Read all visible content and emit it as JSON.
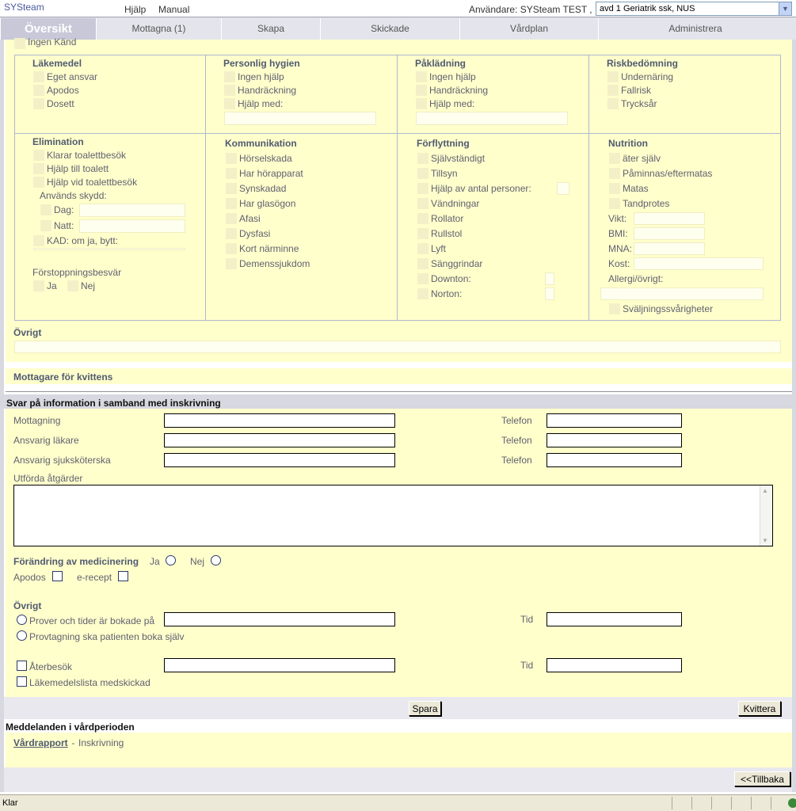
{
  "header": {
    "app_name": "SYSteam",
    "menu_help": "Hjälp",
    "menu_manual": "Manual",
    "user_label": "Användare: SYSteam TEST ,",
    "unit_select": "avd 1 Geriatrik ssk, NUS"
  },
  "tabs": [
    {
      "label": "Översikt"
    },
    {
      "label": "Mottagna (1)"
    },
    {
      "label": "Skapa"
    },
    {
      "label": "Skickade"
    },
    {
      "label": "Vårdplan"
    },
    {
      "label": "Administrera"
    }
  ],
  "top_cut_label": "Ingen Känd",
  "grid": {
    "lakemedel": {
      "title": "Läkemedel",
      "items": [
        "Eget ansvar",
        "Apodos",
        "Dosett"
      ]
    },
    "hygien": {
      "title": "Personlig hygien",
      "items": [
        "Ingen hjälp",
        "Handräckning",
        "Hjälp med:"
      ]
    },
    "pakladning": {
      "title": "Påklädning",
      "items": [
        "Ingen hjälp",
        "Handräckning",
        "Hjälp med:"
      ]
    },
    "risk": {
      "title": "Riskbedömning",
      "items": [
        "Undernäring",
        "Fallrisk",
        "Trycksår"
      ]
    },
    "elimination": {
      "title": "Elimination",
      "items": [
        "Klarar toalettbesök",
        "Hjälp till toalett",
        "Hjälp vid toalettbesök"
      ],
      "skydd_label": "Används skydd:",
      "dag": "Dag:",
      "natt": "Natt:",
      "kad": "KAD: om ja, bytt:",
      "forstoppning": "Förstoppningsbesvär",
      "ja": "Ja",
      "nej": "Nej"
    },
    "kommunikation": {
      "title": "Kommunikation",
      "items": [
        "Hörselskada",
        "Har hörapparat",
        "Synskadad",
        "Har glasögon",
        "Afasi",
        "Dysfasi",
        "Kort närminne",
        "Demenssjukdom"
      ]
    },
    "forflyttning": {
      "title": "Förflyttning",
      "items": [
        "Självständigt",
        "Tillsyn",
        "Hjälp av antal personer:",
        "Vändningar",
        "Rollator",
        "Rullstol",
        "Lyft",
        "Sänggrindar",
        "Downton:",
        "Norton:"
      ]
    },
    "nutrition": {
      "title": "Nutrition",
      "items": [
        "äter själv",
        "Påminnas/eftermatas",
        "Matas",
        "Tandprotes"
      ],
      "vikt": "Vikt:",
      "bmi": "BMI:",
      "mna": "MNA:",
      "kost": "Kost:",
      "allergi": "Allergi/övrigt:",
      "svalj": "Sväljningssvårigheter"
    }
  },
  "ovrigt_top": "Övrigt",
  "mottagare": "Mottagare för kvittens",
  "svar": {
    "title": "Svar på information i samband med inskrivning",
    "mottagning": "Mottagning",
    "lakare": "Ansvarig läkare",
    "ssk": "Ansvarig sjuksköterska",
    "telefon": "Telefon",
    "utforda": "Utförda åtgärder",
    "andring": "Förändring av medicinering",
    "ja": "Ja",
    "nej": "Nej",
    "apodos": "Apodos",
    "erecept": "e-recept",
    "ovrigt": "Övrigt",
    "prover": "Prover och tider är bokade på",
    "provtagning": "Provtagning ska patienten boka själv",
    "tid": "Tid",
    "aterbesok": "Återbesök",
    "lakemedelslista": "Läkemedelslista medskickad"
  },
  "buttons": {
    "spara": "Spara",
    "kvittera": "Kvittera",
    "tillbaka": "<<Tillbaka"
  },
  "meddelanden": {
    "title": "Meddelanden i vårdperioden",
    "link": "Vårdrapport",
    "sep": " - ",
    "text": "Inskrivning"
  },
  "status": {
    "text": "Klar"
  },
  "colors": {
    "panel": "#ffffcc",
    "tab_active": "#c8c8d8",
    "section_bar": "#d8d8e0"
  }
}
